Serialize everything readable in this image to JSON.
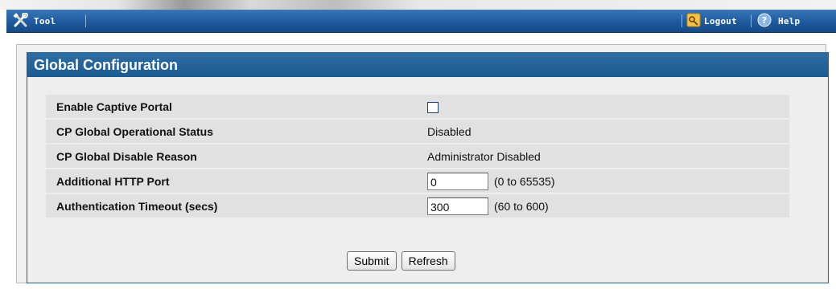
{
  "toolbar": {
    "tool_label": "Tool",
    "logout_label": "Logout",
    "help_label": "Help",
    "tool_icon": "tools-icon",
    "logout_icon": "logout-icon",
    "help_icon": "help-icon"
  },
  "panel": {
    "title": "Global Configuration",
    "rows": [
      {
        "label": "Enable Captive Portal",
        "type": "checkbox",
        "checked": false
      },
      {
        "label": "CP Global Operational Status",
        "type": "text",
        "value": "Disabled"
      },
      {
        "label": "CP Global Disable Reason",
        "type": "text",
        "value": "Administrator Disabled"
      },
      {
        "label": "Additional HTTP Port",
        "type": "input",
        "value": "0",
        "range": "(0 to 65535)"
      },
      {
        "label": "Authentication Timeout (secs)",
        "type": "input",
        "value": "300",
        "range": "(60 to 600)"
      }
    ],
    "submit_label": "Submit",
    "refresh_label": "Refresh"
  },
  "colors": {
    "toolbar_bg": "#1e5a9e",
    "header_bg": "#1d5a90",
    "row_bg": "#e1e1e1"
  }
}
